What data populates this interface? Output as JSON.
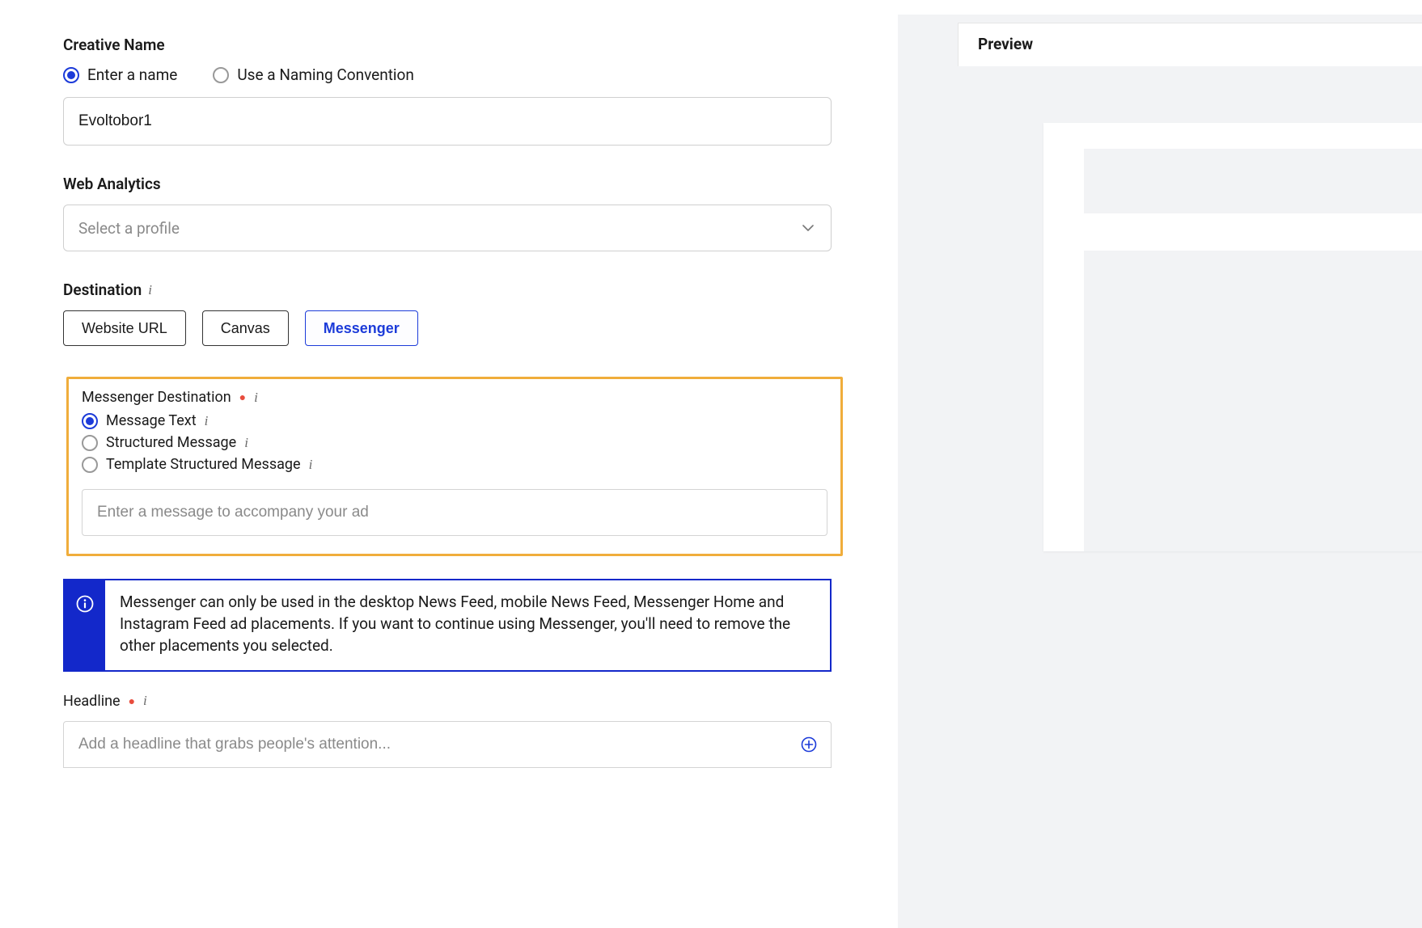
{
  "creativeName": {
    "label": "Creative Name",
    "radios": {
      "enter": "Enter a name",
      "convention": "Use a Naming Convention"
    },
    "value": "Evoltobor1"
  },
  "webAnalytics": {
    "label": "Web Analytics",
    "placeholder": "Select a profile"
  },
  "destination": {
    "label": "Destination",
    "options": {
      "website": "Website URL",
      "canvas": "Canvas",
      "messenger": "Messenger"
    }
  },
  "messengerDest": {
    "label": "Messenger Destination",
    "radios": {
      "text": "Message Text",
      "structured": "Structured Message",
      "template": "Template Structured Message"
    },
    "placeholder": "Enter a message to accompany your ad"
  },
  "alert": {
    "text": "Messenger can only be used in the desktop News Feed, mobile News Feed, Messenger Home and Instagram Feed ad placements. If you want to continue using Messenger, you'll need to remove the other placements you selected."
  },
  "headline": {
    "label": "Headline",
    "placeholder": "Add a headline that grabs people's attention..."
  },
  "preview": {
    "tab": "Preview"
  }
}
